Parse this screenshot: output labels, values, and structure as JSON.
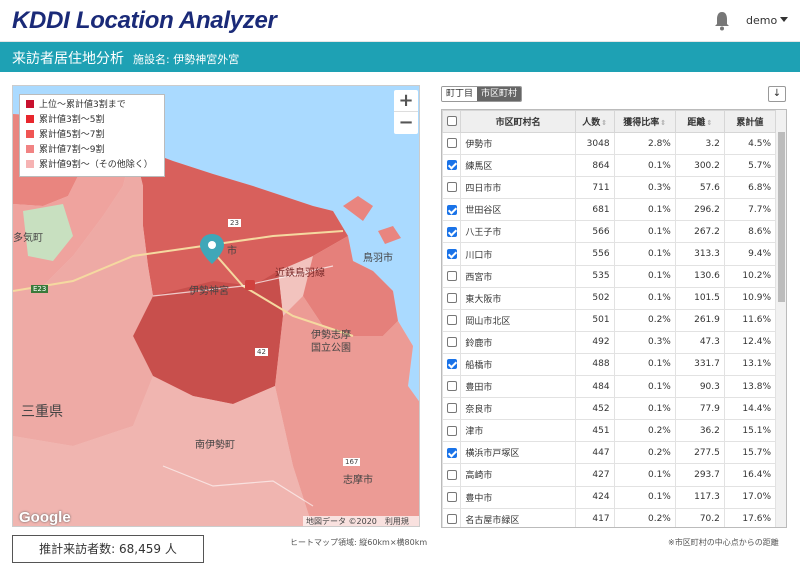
{
  "header": {
    "logo": "KDDI Location Analyzer",
    "user": "demo"
  },
  "subheader": {
    "title": "来訪者居住地分析",
    "facility": "施設名: 伊勢神宮外宮"
  },
  "legend": [
    {
      "label": "上位～累計値3割まで",
      "color": "#c8102e"
    },
    {
      "label": "累計値3割～5割",
      "color": "#e8262d"
    },
    {
      "label": "累計値5割～7割",
      "color": "#f05553"
    },
    {
      "label": "累計値7割～9割",
      "color": "#f18383"
    },
    {
      "label": "累計値9割～（その他除く）",
      "color": "#f6b3b3"
    }
  ],
  "map": {
    "labels": {
      "tashi": "多気町",
      "ise_shrine": "伊勢神宮",
      "kintetsu": "近鉄鳥羽線",
      "ise_shima": "伊勢志摩",
      "park": "国立公園",
      "mie": "三重県",
      "minamiise": "南伊勢町",
      "shima": "志摩市",
      "toba": "鳥羽市",
      "ise_city": "市",
      "e23": "E23",
      "r42": "42",
      "r167": "167",
      "r23": "23"
    },
    "google": "Google",
    "credit": "地図データ ©2020　利用規約"
  },
  "estimate": {
    "label": "推計来訪者数: 68,459 人"
  },
  "heatmap_note": "ヒートマップ領域: 縦60km×横80km",
  "tabs": {
    "tab1": "町丁目",
    "tab2": "市区町村"
  },
  "download_icon": "download-icon",
  "table": {
    "headers": {
      "name": "市区町村名",
      "count": "人数",
      "ratio": "獲得比率",
      "distance": "距離",
      "cumulative": "累計値"
    },
    "rows": [
      {
        "checked": false,
        "name": "伊勢市",
        "count": "3048",
        "ratio": "2.8%",
        "distance": "3.2",
        "cumulative": "4.5%"
      },
      {
        "checked": true,
        "name": "練馬区",
        "count": "864",
        "ratio": "0.1%",
        "distance": "300.2",
        "cumulative": "5.7%"
      },
      {
        "checked": false,
        "name": "四日市市",
        "count": "711",
        "ratio": "0.3%",
        "distance": "57.6",
        "cumulative": "6.8%"
      },
      {
        "checked": true,
        "name": "世田谷区",
        "count": "681",
        "ratio": "0.1%",
        "distance": "296.2",
        "cumulative": "7.7%"
      },
      {
        "checked": true,
        "name": "八王子市",
        "count": "566",
        "ratio": "0.1%",
        "distance": "267.2",
        "cumulative": "8.6%"
      },
      {
        "checked": true,
        "name": "川口市",
        "count": "556",
        "ratio": "0.1%",
        "distance": "313.3",
        "cumulative": "9.4%"
      },
      {
        "checked": false,
        "name": "西宮市",
        "count": "535",
        "ratio": "0.1%",
        "distance": "130.6",
        "cumulative": "10.2%"
      },
      {
        "checked": false,
        "name": "東大阪市",
        "count": "502",
        "ratio": "0.1%",
        "distance": "101.5",
        "cumulative": "10.9%"
      },
      {
        "checked": false,
        "name": "岡山市北区",
        "count": "501",
        "ratio": "0.2%",
        "distance": "261.9",
        "cumulative": "11.6%"
      },
      {
        "checked": false,
        "name": "鈴鹿市",
        "count": "492",
        "ratio": "0.3%",
        "distance": "47.3",
        "cumulative": "12.4%"
      },
      {
        "checked": true,
        "name": "船橋市",
        "count": "488",
        "ratio": "0.1%",
        "distance": "331.7",
        "cumulative": "13.1%"
      },
      {
        "checked": false,
        "name": "豊田市",
        "count": "484",
        "ratio": "0.1%",
        "distance": "90.3",
        "cumulative": "13.8%"
      },
      {
        "checked": false,
        "name": "奈良市",
        "count": "452",
        "ratio": "0.1%",
        "distance": "77.9",
        "cumulative": "14.4%"
      },
      {
        "checked": false,
        "name": "津市",
        "count": "451",
        "ratio": "0.2%",
        "distance": "36.2",
        "cumulative": "15.1%"
      },
      {
        "checked": true,
        "name": "横浜市戸塚区",
        "count": "447",
        "ratio": "0.2%",
        "distance": "277.5",
        "cumulative": "15.7%"
      },
      {
        "checked": false,
        "name": "高崎市",
        "count": "427",
        "ratio": "0.1%",
        "distance": "293.7",
        "cumulative": "16.4%"
      },
      {
        "checked": false,
        "name": "豊中市",
        "count": "424",
        "ratio": "0.1%",
        "distance": "117.3",
        "cumulative": "17.0%"
      },
      {
        "checked": false,
        "name": "名古屋市緑区",
        "count": "417",
        "ratio": "0.2%",
        "distance": "70.2",
        "cumulative": "17.6%"
      }
    ]
  },
  "distance_note": "※市区町村の中心点からの距離"
}
